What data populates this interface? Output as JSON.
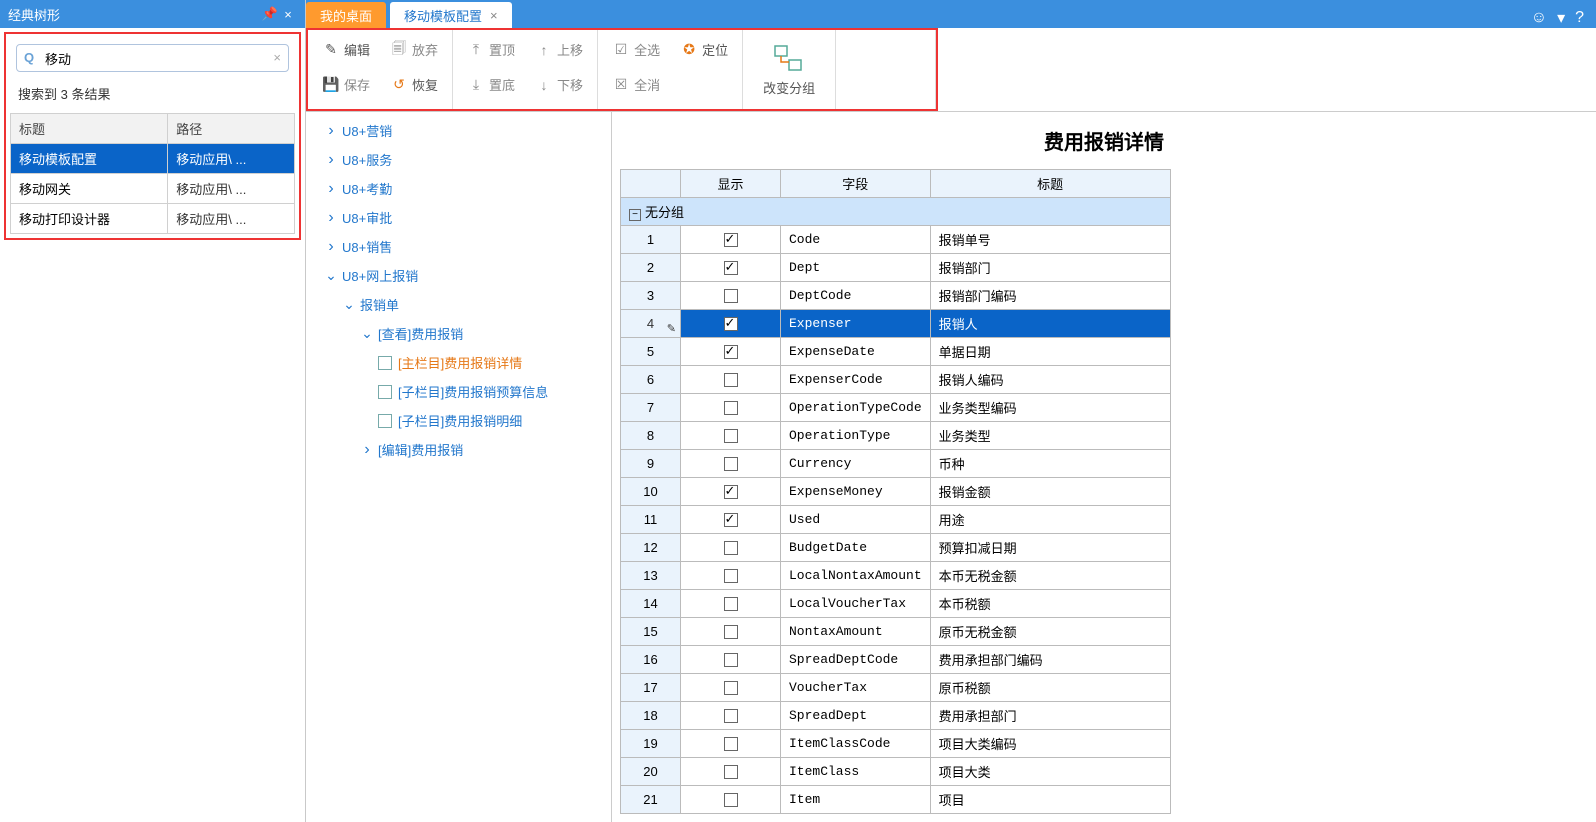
{
  "sidebar": {
    "title": "经典树形",
    "search_value": "移动",
    "result_text": "搜索到 3 条结果",
    "columns": {
      "title": "标题",
      "path": "路径"
    },
    "results": [
      {
        "title": "移动模板配置",
        "path": "移动应用\\ ...",
        "selected": true
      },
      {
        "title": "移动网关",
        "path": "移动应用\\ ..."
      },
      {
        "title": "移动打印设计器",
        "path": "移动应用\\ ..."
      }
    ]
  },
  "tabs": {
    "t1": "我的桌面",
    "t2": "移动模板配置"
  },
  "toolbar": {
    "edit": "编辑",
    "discard": "放弃",
    "save": "保存",
    "restore": "恢复",
    "top": "置顶",
    "up": "上移",
    "bottom": "置底",
    "down": "下移",
    "selectall": "全选",
    "locate": "定位",
    "deselect": "全消",
    "changegroup": "改变分组"
  },
  "tree": {
    "n1": "U8+营销",
    "n2": "U8+服务",
    "n3": "U8+考勤",
    "n4": "U8+审批",
    "n5": "U8+销售",
    "n6": "U8+网上报销",
    "n7": "报销单",
    "n8": "[查看]费用报销",
    "n9": "[主栏目]费用报销详情",
    "n10": "[子栏目]费用报销预算信息",
    "n11": "[子栏目]费用报销明细",
    "n12": "[编辑]费用报销"
  },
  "detail_title": "费用报销详情",
  "grid": {
    "headers": {
      "show": "显示",
      "field": "字段",
      "title": "标题"
    },
    "group": "无分组",
    "rows": [
      {
        "n": "1",
        "checked": true,
        "field": "Code",
        "title": "报销单号"
      },
      {
        "n": "2",
        "checked": true,
        "field": "Dept",
        "title": "报销部门"
      },
      {
        "n": "3",
        "checked": false,
        "field": "DeptCode",
        "title": "报销部门编码"
      },
      {
        "n": "4",
        "checked": true,
        "field": "Expenser",
        "title": "报销人",
        "selected": true,
        "editing": true
      },
      {
        "n": "5",
        "checked": true,
        "field": "ExpenseDate",
        "title": "单据日期"
      },
      {
        "n": "6",
        "checked": false,
        "field": "ExpenserCode",
        "title": "报销人编码"
      },
      {
        "n": "7",
        "checked": false,
        "field": "OperationTypeCode",
        "title": "业务类型编码"
      },
      {
        "n": "8",
        "checked": false,
        "field": "OperationType",
        "title": "业务类型"
      },
      {
        "n": "9",
        "checked": false,
        "field": "Currency",
        "title": "币种"
      },
      {
        "n": "10",
        "checked": true,
        "field": "ExpenseMoney",
        "title": "报销金额"
      },
      {
        "n": "11",
        "checked": true,
        "field": "Used",
        "title": "用途"
      },
      {
        "n": "12",
        "checked": false,
        "field": "BudgetDate",
        "title": "预算扣减日期"
      },
      {
        "n": "13",
        "checked": false,
        "field": "LocalNontaxAmount",
        "title": "本币无税金额"
      },
      {
        "n": "14",
        "checked": false,
        "field": "LocalVoucherTax",
        "title": "本币税额"
      },
      {
        "n": "15",
        "checked": false,
        "field": "NontaxAmount",
        "title": "原币无税金额"
      },
      {
        "n": "16",
        "checked": false,
        "field": "SpreadDeptCode",
        "title": "费用承担部门编码"
      },
      {
        "n": "17",
        "checked": false,
        "field": "VoucherTax",
        "title": "原币税额"
      },
      {
        "n": "18",
        "checked": false,
        "field": "SpreadDept",
        "title": "费用承担部门"
      },
      {
        "n": "19",
        "checked": false,
        "field": "ItemClassCode",
        "title": "项目大类编码"
      },
      {
        "n": "20",
        "checked": false,
        "field": "ItemClass",
        "title": "项目大类"
      },
      {
        "n": "21",
        "checked": false,
        "field": "Item",
        "title": "项目"
      }
    ]
  }
}
